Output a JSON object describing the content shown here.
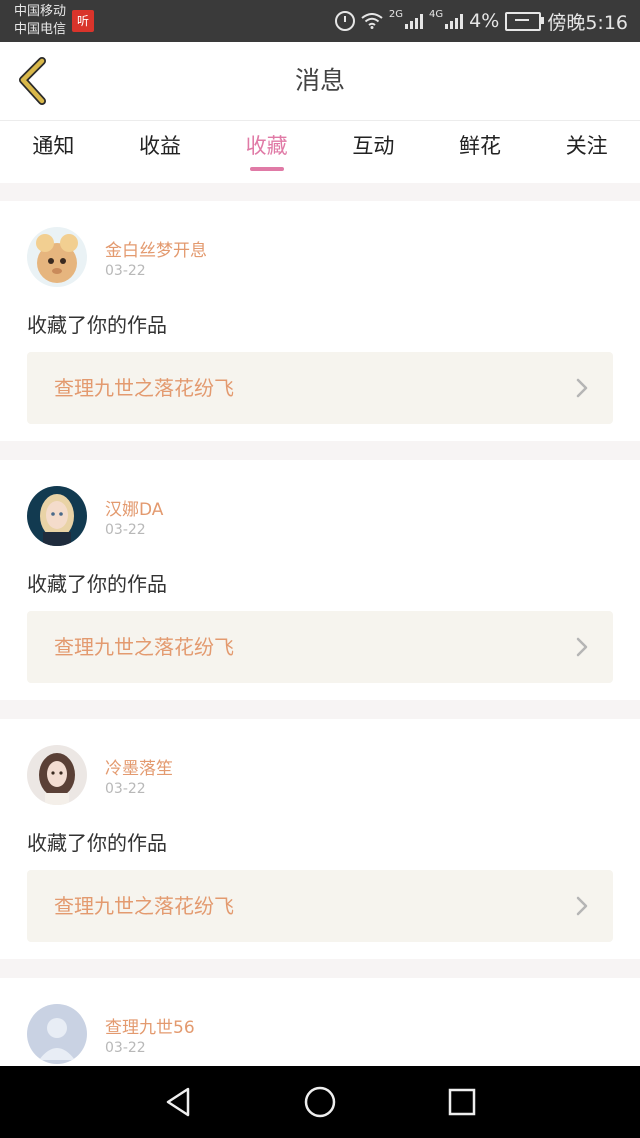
{
  "status_bar": {
    "carrier_1": "中国移动",
    "carrier_2": "中国电信",
    "carrier_badge": "听",
    "net_2g": "2G",
    "net_4g": "4G",
    "battery_percent": "4%",
    "time": "傍晚5:16"
  },
  "header": {
    "title": "消息",
    "back_icon": "chevron-left-icon"
  },
  "tabs": [
    {
      "label": "通知",
      "active": false
    },
    {
      "label": "收益",
      "active": false
    },
    {
      "label": "收藏",
      "active": true
    },
    {
      "label": "互动",
      "active": false
    },
    {
      "label": "鲜花",
      "active": false
    },
    {
      "label": "关注",
      "active": false
    }
  ],
  "messages": [
    {
      "user": "金白丝梦开息",
      "date": "03-22",
      "action": "收藏了你的作品",
      "work": "查理九世之落花纷飞"
    },
    {
      "user": "汉娜DA",
      "date": "03-22",
      "action": "收藏了你的作品",
      "work": "查理九世之落花纷飞"
    },
    {
      "user": "冷墨落笙",
      "date": "03-22",
      "action": "收藏了你的作品",
      "work": "查理九世之落花纷飞"
    },
    {
      "user": "查理九世56",
      "date": "03-22"
    }
  ],
  "colors": {
    "accent_pink": "#e07aa6",
    "name_orange": "#e39a6f",
    "back_yellow": "#d9b84a"
  },
  "nav": {
    "back": "triangle-back-icon",
    "home": "circle-home-icon",
    "recents": "square-recents-icon"
  }
}
